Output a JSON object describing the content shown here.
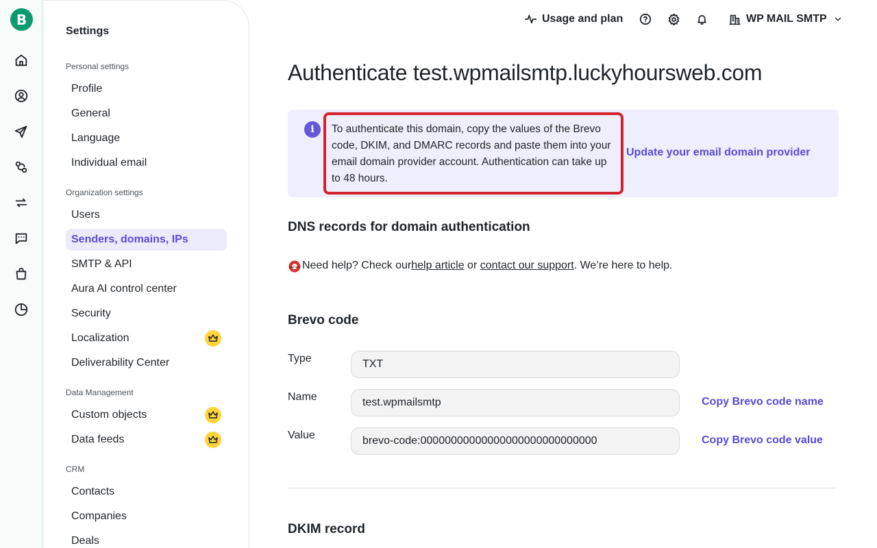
{
  "app": {
    "logo_letter": "B"
  },
  "rail": {
    "icons": [
      "home-icon",
      "contacts-icon",
      "campaigns-send-icon",
      "automations-icon",
      "transactional-icon",
      "conversations-icon",
      "sales-bag-icon",
      "reports-pie-icon"
    ]
  },
  "settings": {
    "title": "Settings",
    "sections": {
      "personal": "Personal settings",
      "organization": "Organization settings",
      "data": "Data Management",
      "crm": "CRM"
    },
    "personal_items": [
      "Profile",
      "General",
      "Language",
      "Individual email"
    ],
    "organization_items": [
      "Users",
      "Senders, domains, IPs",
      "SMTP & API",
      "Aura AI control center",
      "Security",
      "Localization",
      "Deliverability Center"
    ],
    "data_items": [
      "Custom objects",
      "Data feeds"
    ],
    "crm_items": [
      "Contacts",
      "Companies",
      "Deals"
    ],
    "active_item": "Senders, domains, IPs",
    "premium_items": [
      "Localization",
      "Custom objects",
      "Data feeds"
    ]
  },
  "topbar": {
    "usage_label": "Usage and plan",
    "account_label": "WP MAIL SMTP"
  },
  "main": {
    "title": "Authenticate test.wpmailsmtp.luckyhoursweb.com",
    "info": {
      "text": "To authenticate this domain, copy the values of the Brevo code, DKIM, and DMARC records and paste them into your email domain provider account. Authentication can take up to 48 hours.",
      "link": "Update your email domain provider"
    },
    "dns_heading": "DNS records for domain authentication",
    "help": {
      "prefix": "Need help? Check our ",
      "link1": "help article",
      "middle": " or ",
      "link2": "contact our support",
      "suffix": ". We’re here to help."
    },
    "brevo": {
      "heading": "Brevo code",
      "type_label": "Type",
      "type_value": "TXT",
      "name_label": "Name",
      "name_value": "test.wpmailsmtp",
      "value_label": "Value",
      "value_value": "brevo-code:00000000000000000000000000000",
      "copy_name": "Copy Brevo code name",
      "copy_value": "Copy Brevo code value"
    },
    "dkim_heading": "DKIM record"
  },
  "colors": {
    "brand_green": "#0b996e",
    "accent_purple": "#5a4ad6",
    "info_bg": "#efeefc",
    "highlight_red": "#d3232f",
    "premium_yellow": "#ffd43b"
  }
}
